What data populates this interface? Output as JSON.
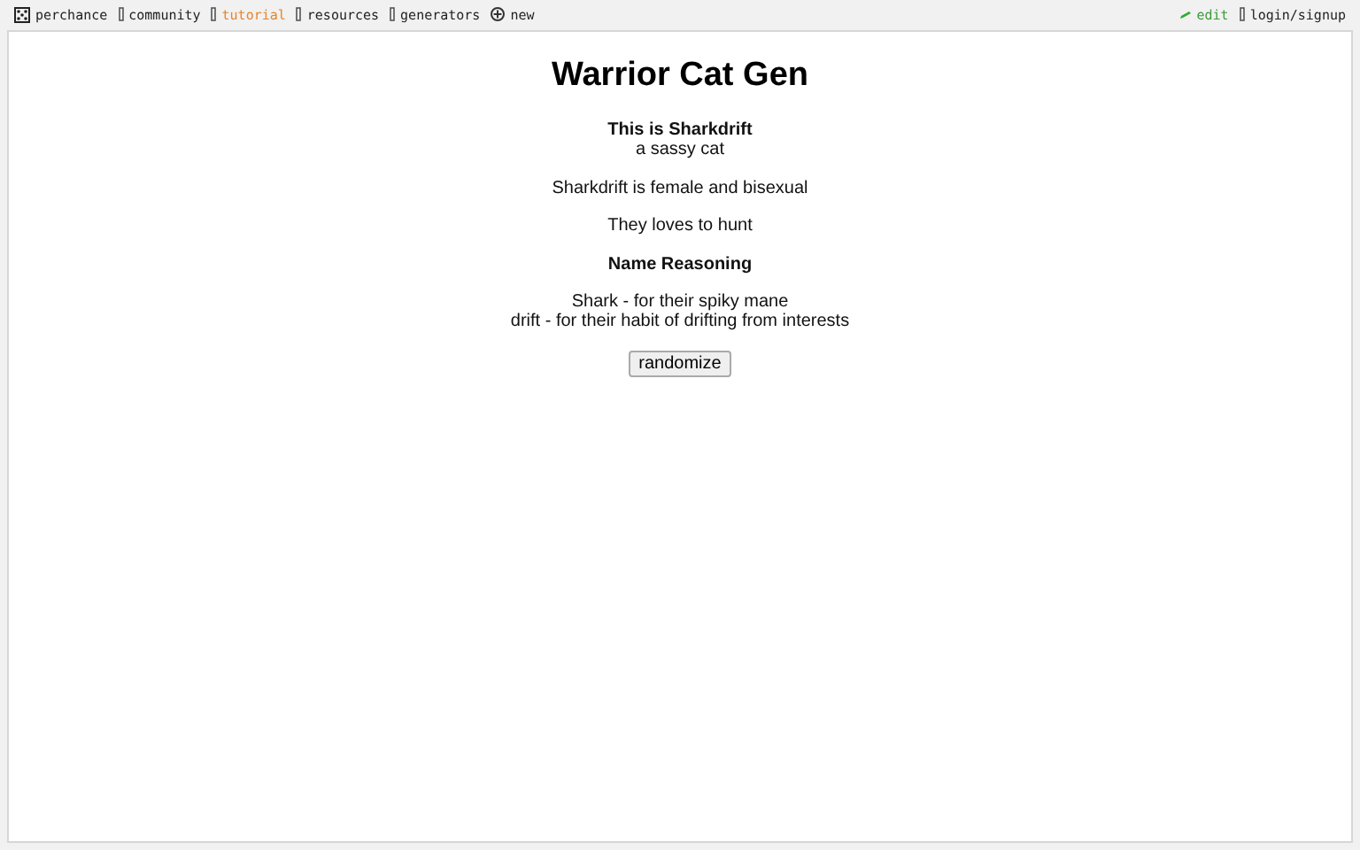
{
  "nav": {
    "left": [
      {
        "label": "perchance",
        "kind": "dice",
        "selected": false
      },
      {
        "label": "community",
        "kind": "plain",
        "selected": false
      },
      {
        "label": "tutorial",
        "kind": "plain",
        "selected": true
      },
      {
        "label": "resources",
        "kind": "plain",
        "selected": false
      },
      {
        "label": "generators",
        "kind": "plain",
        "selected": false
      },
      {
        "label": "new",
        "kind": "plus",
        "selected": false
      }
    ],
    "right": [
      {
        "label": "edit",
        "kind": "edit"
      },
      {
        "label": "login/signup",
        "kind": "plain"
      }
    ]
  },
  "title": "Warrior Cat Gen",
  "paragraphs": [
    [
      {
        "text": "This is Sharkdrift",
        "kind": "bold"
      },
      {
        "text": "a sassy cat",
        "kind": "plain"
      }
    ],
    [
      {
        "text": "Sharkdrift is female and bisexual",
        "kind": "plain"
      }
    ],
    [
      {
        "text": "They loves to hunt",
        "kind": "plain"
      }
    ],
    [
      {
        "text": "Name Reasoning",
        "kind": "bold"
      }
    ],
    [
      {
        "text": "Shark - for their spiky mane",
        "kind": "plain"
      },
      {
        "text": "drift - for their habit of drifting from interests",
        "kind": "plain"
      }
    ]
  ],
  "button": "randomize"
}
